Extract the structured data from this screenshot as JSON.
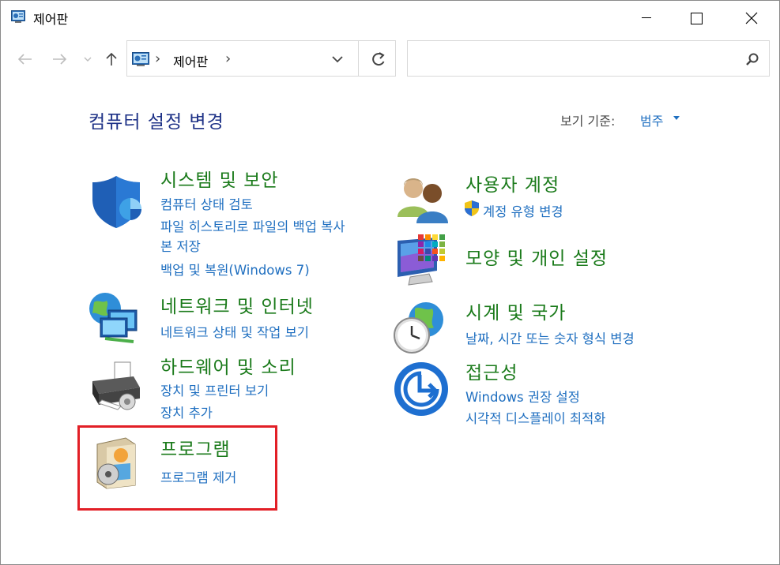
{
  "window": {
    "title": "제어판"
  },
  "titlebar": {
    "icon": "control-panel-icon",
    "minimize": "minimize-icon",
    "maximize": "maximize-icon",
    "close": "close-icon"
  },
  "nav": {
    "back": "back-arrow-icon",
    "forward": "forward-arrow-icon",
    "recent": "chevron-down-icon",
    "up": "up-arrow-icon",
    "address": {
      "icon": "control-panel-icon",
      "location": "제어판"
    },
    "refresh": "refresh-icon",
    "search": {
      "placeholder": "",
      "icon": "search-icon"
    }
  },
  "header": {
    "title": "컴퓨터 설정 변경",
    "view_by_label": "보기 기준:",
    "view_by_value": "범주"
  },
  "categories": {
    "system_security": {
      "title": "시스템 및 보안",
      "icon": "shield-icon",
      "links": [
        "컴퓨터 상태 검토",
        "파일 히스토리로 파일의 백업 복사",
        "본 저장",
        "백업 및 복원(Windows 7)"
      ]
    },
    "network": {
      "title": "네트워크 및 인터넷",
      "icon": "network-globe-icon",
      "links": [
        "네트워크 상태 및 작업 보기"
      ]
    },
    "hardware": {
      "title": "하드웨어 및 소리",
      "icon": "printer-icon",
      "links": [
        "장치 및 프린터 보기",
        "장치 추가"
      ]
    },
    "programs": {
      "title": "프로그램",
      "icon": "program-box-icon",
      "links": [
        "프로그램 제거"
      ]
    },
    "user_accounts": {
      "title": "사용자 계정",
      "icon": "users-icon",
      "links": [
        "계정 유형 변경"
      ],
      "link_icon": "uac-shield-icon"
    },
    "appearance": {
      "title": "모양 및 개인 설정",
      "icon": "monitor-colors-icon",
      "links": []
    },
    "clock_region": {
      "title": "시계 및 국가",
      "icon": "clock-globe-icon",
      "links": [
        "날짜, 시간 또는 숫자 형식 변경"
      ]
    },
    "ease_of_access": {
      "title": "접근성",
      "icon": "accessibility-icon",
      "links": [
        "Windows 권장 설정",
        "시각적 디스플레이 최적화"
      ]
    }
  },
  "colors": {
    "title_blue": "#1e3287",
    "category_green": "#1a7a1a",
    "link_blue": "#1f6fc0",
    "highlight_red": "#e21f26"
  }
}
